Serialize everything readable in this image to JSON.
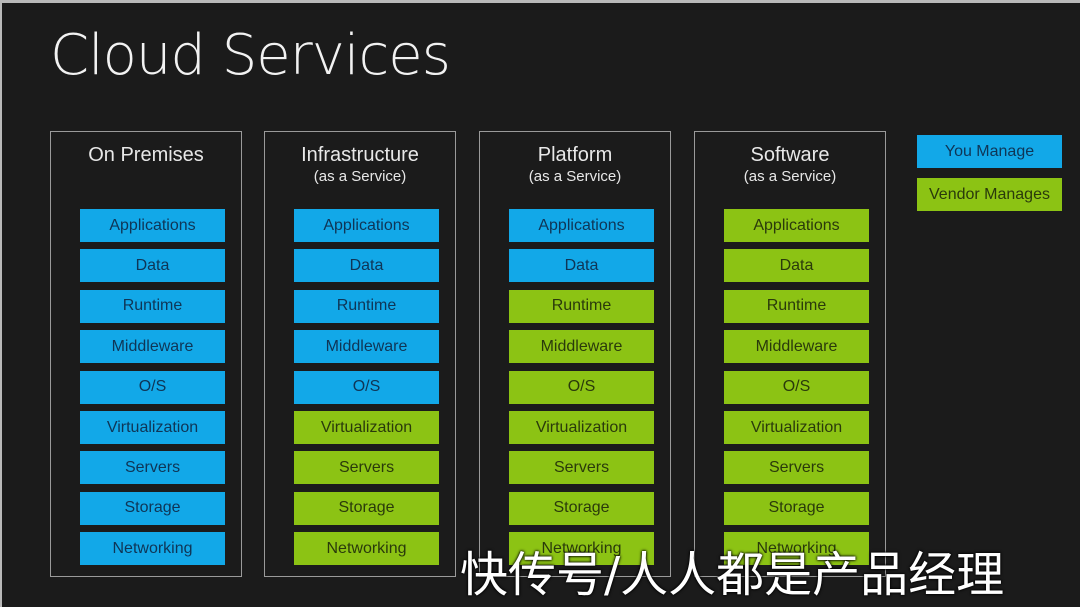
{
  "slide": {
    "title": "Cloud Services"
  },
  "legend": {
    "you_manage": {
      "label": "You Manage",
      "color": "#12a8e8"
    },
    "vendor_manages": {
      "label": "Vendor Manages",
      "color": "#8cc314"
    }
  },
  "columns": [
    {
      "name": "On Premises",
      "subtitle": "",
      "layers": [
        {
          "label": "Applications",
          "managed_by": "you"
        },
        {
          "label": "Data",
          "managed_by": "you"
        },
        {
          "label": "Runtime",
          "managed_by": "you"
        },
        {
          "label": "Middleware",
          "managed_by": "you"
        },
        {
          "label": "O/S",
          "managed_by": "you"
        },
        {
          "label": "Virtualization",
          "managed_by": "you"
        },
        {
          "label": "Servers",
          "managed_by": "you"
        },
        {
          "label": "Storage",
          "managed_by": "you"
        },
        {
          "label": "Networking",
          "managed_by": "you"
        }
      ]
    },
    {
      "name": "Infrastructure",
      "subtitle": "(as a Service)",
      "layers": [
        {
          "label": "Applications",
          "managed_by": "you"
        },
        {
          "label": "Data",
          "managed_by": "you"
        },
        {
          "label": "Runtime",
          "managed_by": "you"
        },
        {
          "label": "Middleware",
          "managed_by": "you"
        },
        {
          "label": "O/S",
          "managed_by": "you"
        },
        {
          "label": "Virtualization",
          "managed_by": "vendor"
        },
        {
          "label": "Servers",
          "managed_by": "vendor"
        },
        {
          "label": "Storage",
          "managed_by": "vendor"
        },
        {
          "label": "Networking",
          "managed_by": "vendor"
        }
      ]
    },
    {
      "name": "Platform",
      "subtitle": "(as a Service)",
      "layers": [
        {
          "label": "Applications",
          "managed_by": "you"
        },
        {
          "label": "Data",
          "managed_by": "you"
        },
        {
          "label": "Runtime",
          "managed_by": "vendor"
        },
        {
          "label": "Middleware",
          "managed_by": "vendor"
        },
        {
          "label": "O/S",
          "managed_by": "vendor"
        },
        {
          "label": "Virtualization",
          "managed_by": "vendor"
        },
        {
          "label": "Servers",
          "managed_by": "vendor"
        },
        {
          "label": "Storage",
          "managed_by": "vendor"
        },
        {
          "label": "Networking",
          "managed_by": "vendor"
        }
      ]
    },
    {
      "name": "Software",
      "subtitle": "(as a Service)",
      "layers": [
        {
          "label": "Applications",
          "managed_by": "vendor"
        },
        {
          "label": "Data",
          "managed_by": "vendor"
        },
        {
          "label": "Runtime",
          "managed_by": "vendor"
        },
        {
          "label": "Middleware",
          "managed_by": "vendor"
        },
        {
          "label": "O/S",
          "managed_by": "vendor"
        },
        {
          "label": "Virtualization",
          "managed_by": "vendor"
        },
        {
          "label": "Servers",
          "managed_by": "vendor"
        },
        {
          "label": "Storage",
          "managed_by": "vendor"
        },
        {
          "label": "Networking",
          "managed_by": "vendor"
        }
      ]
    }
  ],
  "watermark": "快传号/人人都是产品经理"
}
